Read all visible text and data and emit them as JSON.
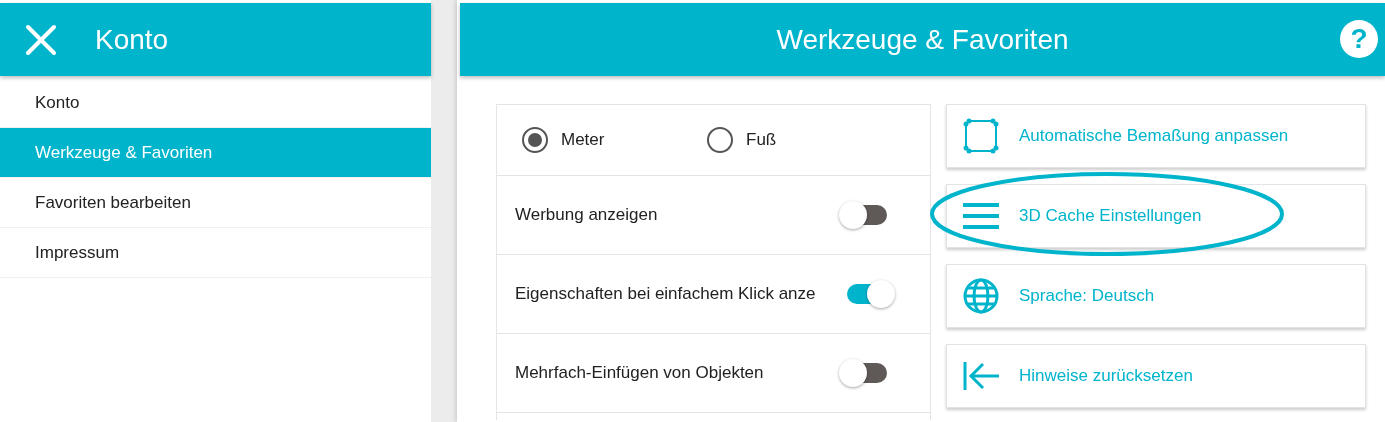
{
  "sidebar": {
    "title": "Konto",
    "items": [
      {
        "label": "Konto",
        "selected": false
      },
      {
        "label": "Werkzeuge & Favoriten",
        "selected": true
      },
      {
        "label": "Favoriten bearbeiten",
        "selected": false
      },
      {
        "label": "Impressum",
        "selected": false
      }
    ]
  },
  "main": {
    "title": "Werkzeuge & Favoriten",
    "help": "?"
  },
  "units": [
    {
      "label": "Meter",
      "selected": true
    },
    {
      "label": "Fuß",
      "selected": false
    }
  ],
  "toggles": [
    {
      "label": "Werbung anzeigen",
      "on": false
    },
    {
      "label": "Eigenschaften bei einfachem Klick anze",
      "on": true
    },
    {
      "label": "Mehrfach-Einfügen von Objekten",
      "on": false
    }
  ],
  "actions": [
    {
      "label": "Automatische Bemaßung anpassen",
      "kind": "dimensions",
      "highlighted": false
    },
    {
      "label": "3D Cache Einstellungen",
      "kind": "menu",
      "highlighted": true
    },
    {
      "label": "Sprache: Deutsch",
      "kind": "globe",
      "highlighted": false
    },
    {
      "label": "Hinweise zurücksetzen",
      "kind": "back",
      "highlighted": false
    }
  ]
}
